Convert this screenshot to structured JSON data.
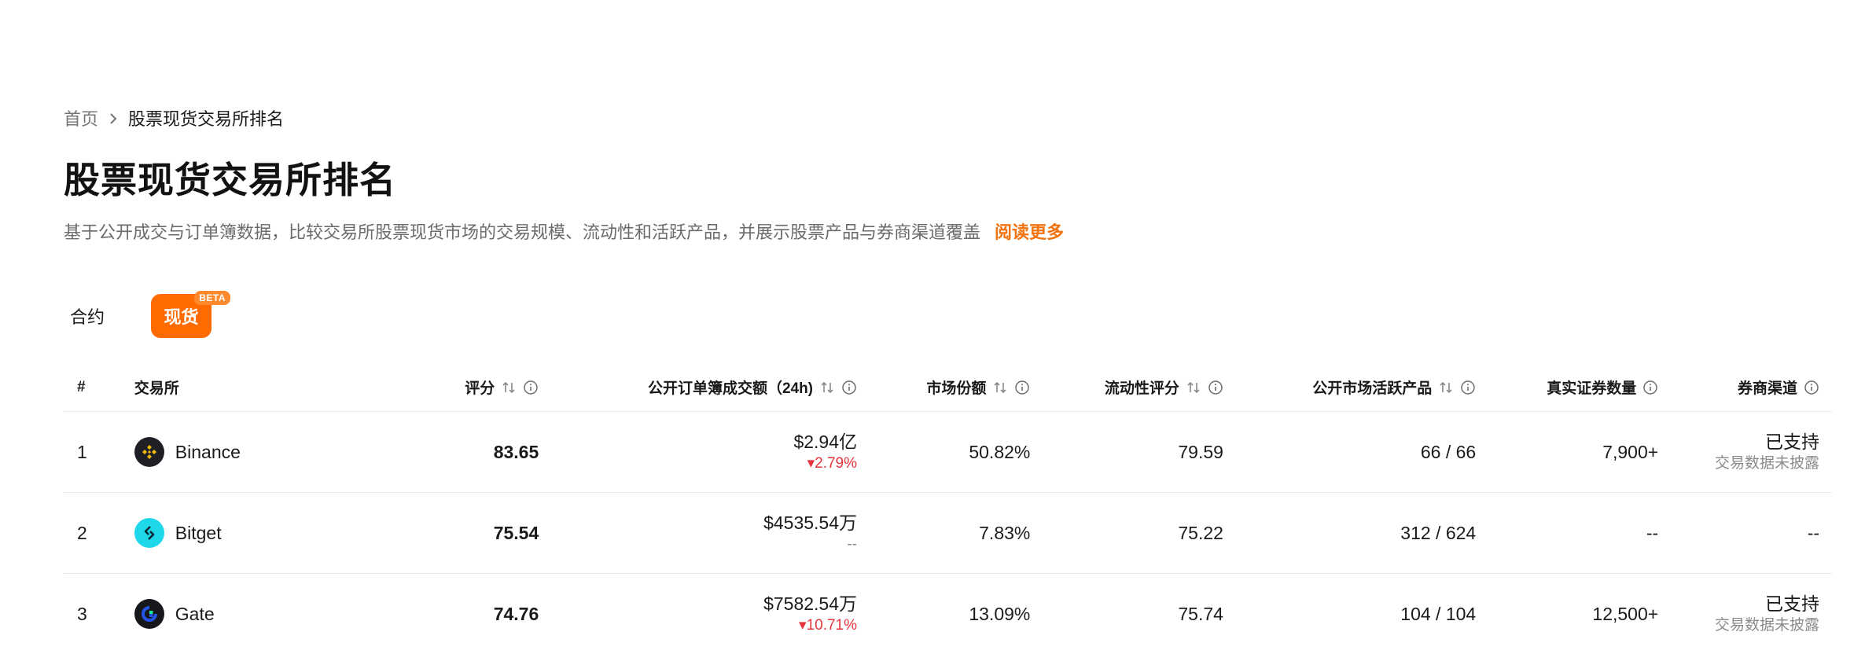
{
  "breadcrumb": {
    "home": "首页",
    "current": "股票现货交易所排名"
  },
  "page": {
    "title": "股票现货交易所排名",
    "description": "基于公开成交与订单簿数据，比较交易所股票现货市场的交易规模、流动性和活跃产品，并展示股票产品与券商渠道覆盖",
    "read_more": "阅读更多"
  },
  "tabs": [
    {
      "label": "合约",
      "active": false
    },
    {
      "label": "现货",
      "active": true,
      "badge": "BETA"
    }
  ],
  "colors": {
    "accent": "#ff6b00",
    "link": "#f2720c",
    "down": "#e5343d"
  },
  "table": {
    "headers": {
      "rank": "#",
      "exchange": "交易所",
      "score": "评分",
      "volume": "公开订单簿成交额（24h)",
      "share": "市场份额",
      "liquidity": "流动性评分",
      "active": "公开市场活跃产品",
      "securities": "真实证券数量",
      "broker": "券商渠道"
    },
    "rows": [
      {
        "rank": "1",
        "exchange": "Binance",
        "icon": "binance-logo-icon",
        "score": "83.65",
        "volume": "$2.94亿",
        "change": "▾2.79%",
        "share": "50.82%",
        "liquidity": "79.59",
        "active": "66 / 66",
        "securities": "7,900+",
        "broker": "已支持",
        "broker_note": "交易数据未披露"
      },
      {
        "rank": "2",
        "exchange": "Bitget",
        "icon": "bitget-logo-icon",
        "score": "75.54",
        "volume": "$4535.54万",
        "change": "--",
        "share": "7.83%",
        "liquidity": "75.22",
        "active": "312 / 624",
        "securities": "--",
        "broker": "--",
        "broker_note": ""
      },
      {
        "rank": "3",
        "exchange": "Gate",
        "icon": "gate-logo-icon",
        "score": "74.76",
        "volume": "$7582.54万",
        "change": "▾10.71%",
        "share": "13.09%",
        "liquidity": "75.74",
        "active": "104 / 104",
        "securities": "12,500+",
        "broker": "已支持",
        "broker_note": "交易数据未披露"
      }
    ]
  }
}
